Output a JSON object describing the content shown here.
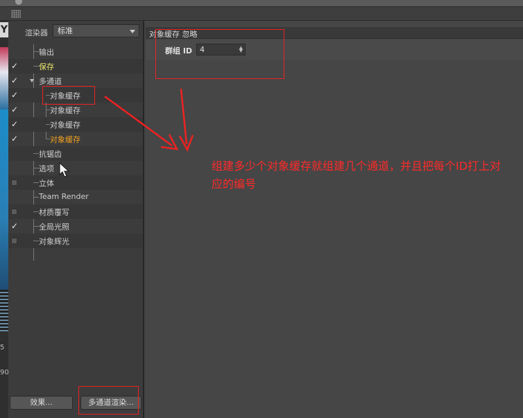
{
  "renderer": {
    "label": "渲染器",
    "selected": "标准"
  },
  "tree": {
    "items": [
      {
        "label": "输出",
        "checked": null,
        "color": "normal"
      },
      {
        "label": "保存",
        "checked": true,
        "color": "yellow"
      },
      {
        "label": "多通道",
        "checked": true,
        "color": "normal"
      },
      {
        "label": "对象缓存",
        "checked": true,
        "color": "normal"
      },
      {
        "label": "对象缓存",
        "checked": true,
        "color": "normal"
      },
      {
        "label": "对象缓存",
        "checked": true,
        "color": "normal"
      },
      {
        "label": "对象缓存",
        "checked": true,
        "color": "orange"
      },
      {
        "label": "抗锯齿",
        "checked": null,
        "color": "normal"
      },
      {
        "label": "选项",
        "checked": null,
        "color": "normal"
      },
      {
        "label": "立体",
        "checked": false,
        "color": "normal"
      },
      {
        "label": "Team Render",
        "checked": null,
        "color": "normal"
      },
      {
        "label": "材质覆写",
        "checked": false,
        "color": "normal"
      },
      {
        "label": "全局光照",
        "checked": true,
        "color": "normal"
      },
      {
        "label": "对象辉光",
        "checked": false,
        "color": "normal"
      }
    ]
  },
  "buttons": {
    "effects": "效果...",
    "multipass": "多通道渲染..."
  },
  "right_panel": {
    "title": "对象缓存 忽略",
    "group_id_label": "群组 ID",
    "group_id_value": "4"
  },
  "annotation": "组建多少个对象缓存就组建几个通道，并且把每个ID打上对应的编号",
  "background_app": {
    "numbers": [
      "5",
      "90"
    ]
  },
  "colors": {
    "annotation_red": "#ee2222",
    "selected_orange": "#f0a020",
    "save_yellow": "#e8e36a"
  }
}
